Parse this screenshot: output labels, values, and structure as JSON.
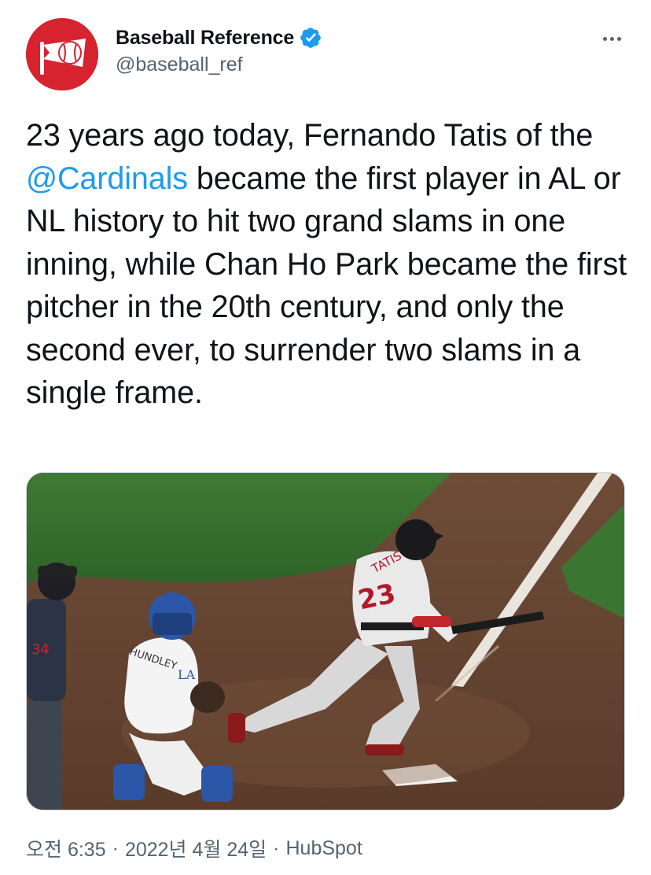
{
  "author": {
    "display_name": "Baseball Reference",
    "handle": "@baseball_ref",
    "verified": true,
    "avatar_icon": "pennant-baseball-logo-icon",
    "avatar_color": "#d6232f"
  },
  "menu": {
    "more_icon": "more-horizontal-icon"
  },
  "tweet": {
    "text_before": "23 years ago today, Fernando Tatis of the ",
    "mention": "@Cardinals",
    "text_after": " became the first player in AL or NL history to hit two grand slams in one inning, while Chan Ho Park became the first pitcher in the 20th century, and only the second ever, to surrender two slams in a single frame."
  },
  "media": {
    "type": "photo",
    "jersey_name": "TATIS",
    "jersey_number": "23",
    "catcher_name": "HUNDLEY",
    "catcher_logo": "LA",
    "umpire_number": "34"
  },
  "meta": {
    "time": "오전 6:35",
    "date": "2022년 4월 24일",
    "separator": "·",
    "source": "HubSpot"
  },
  "colors": {
    "accent": "#1d9bf0",
    "secondary_text": "#536471",
    "primary_text": "#0f1419"
  }
}
